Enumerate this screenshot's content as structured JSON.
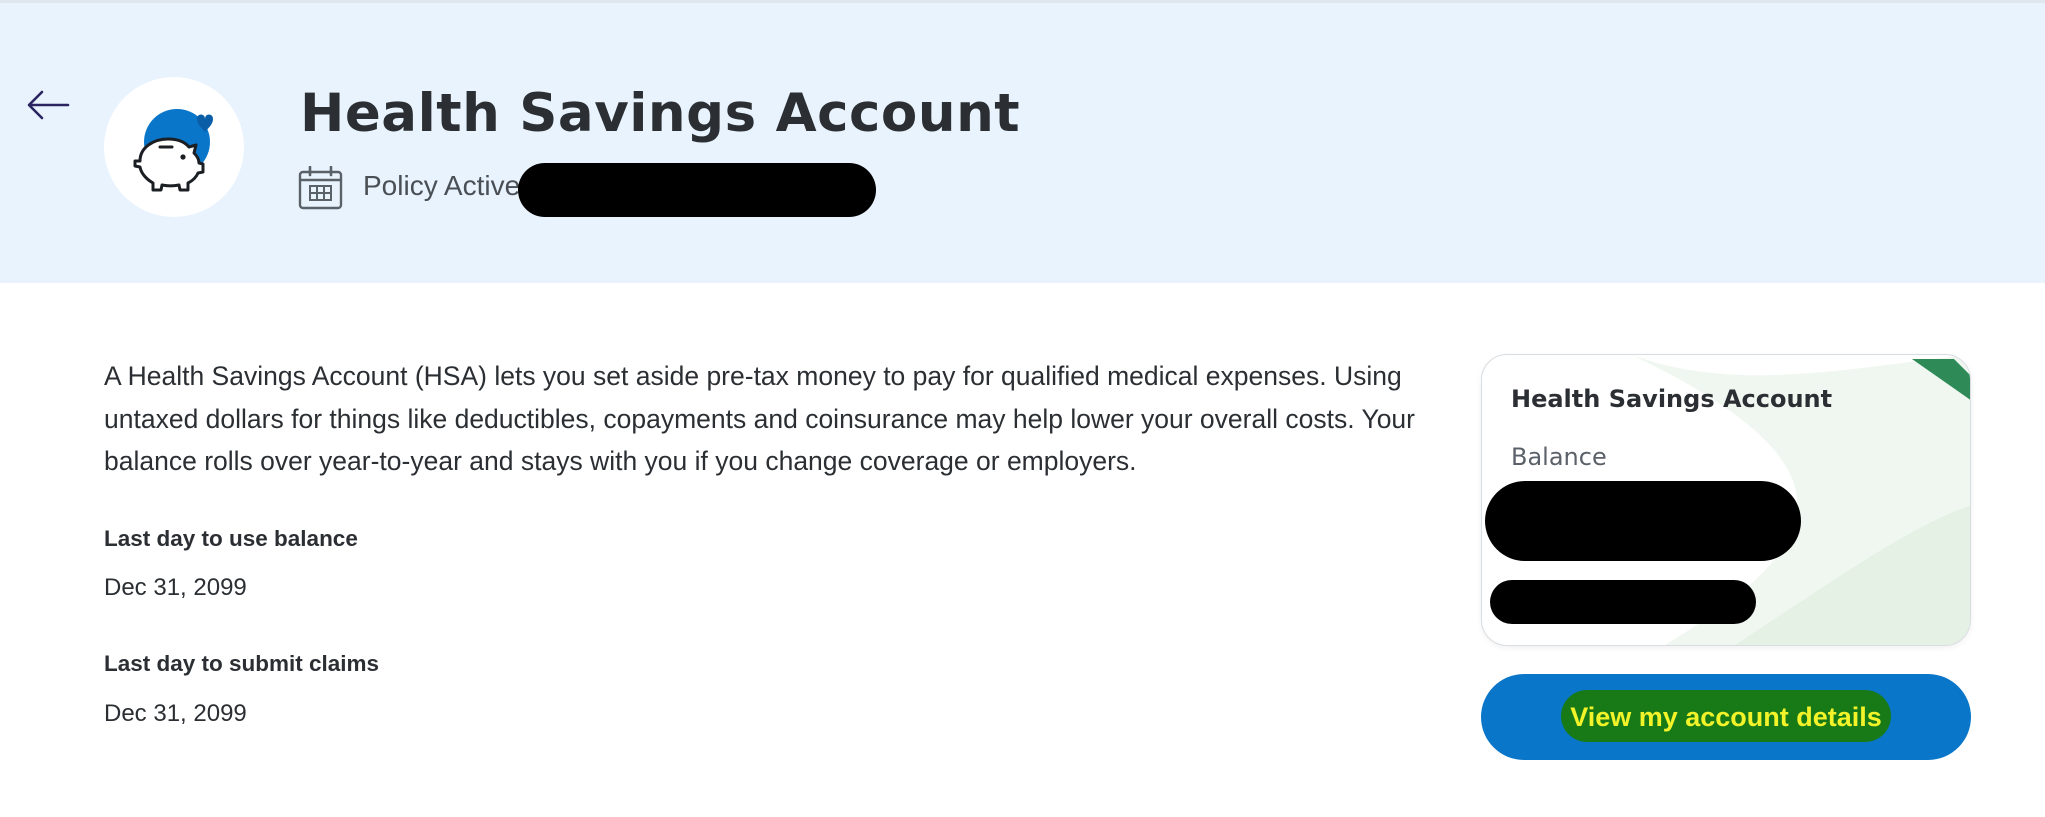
{
  "header": {
    "title": "Health Savings Account",
    "status": "Policy Active",
    "icons": {
      "back": "back-arrow-icon",
      "avatar": "piggy-bank-icon",
      "calendar": "calendar-icon"
    }
  },
  "main": {
    "description": "A Health Savings Account (HSA) lets you set aside pre-tax money to pay for qualified medical expenses. Using untaxed dollars for things like deductibles, copayments and coinsurance may help lower your overall costs. Your balance rolls over year-to-year and stays with you if you change coverage or employers.",
    "fields": [
      {
        "label": "Last day to use balance",
        "value": "Dec 31, 2099"
      },
      {
        "label": "Last day to submit claims",
        "value": "Dec 31, 2099"
      }
    ]
  },
  "card": {
    "title": "Health Savings Account",
    "balance_label": "Balance"
  },
  "actions": {
    "view_details_label": "View my account details"
  },
  "colors": {
    "header_bg": "#e8f3fd",
    "accent_blue": "#0a76c9",
    "text": "#2b2f33",
    "card_ribbon": "#2e8b57"
  }
}
